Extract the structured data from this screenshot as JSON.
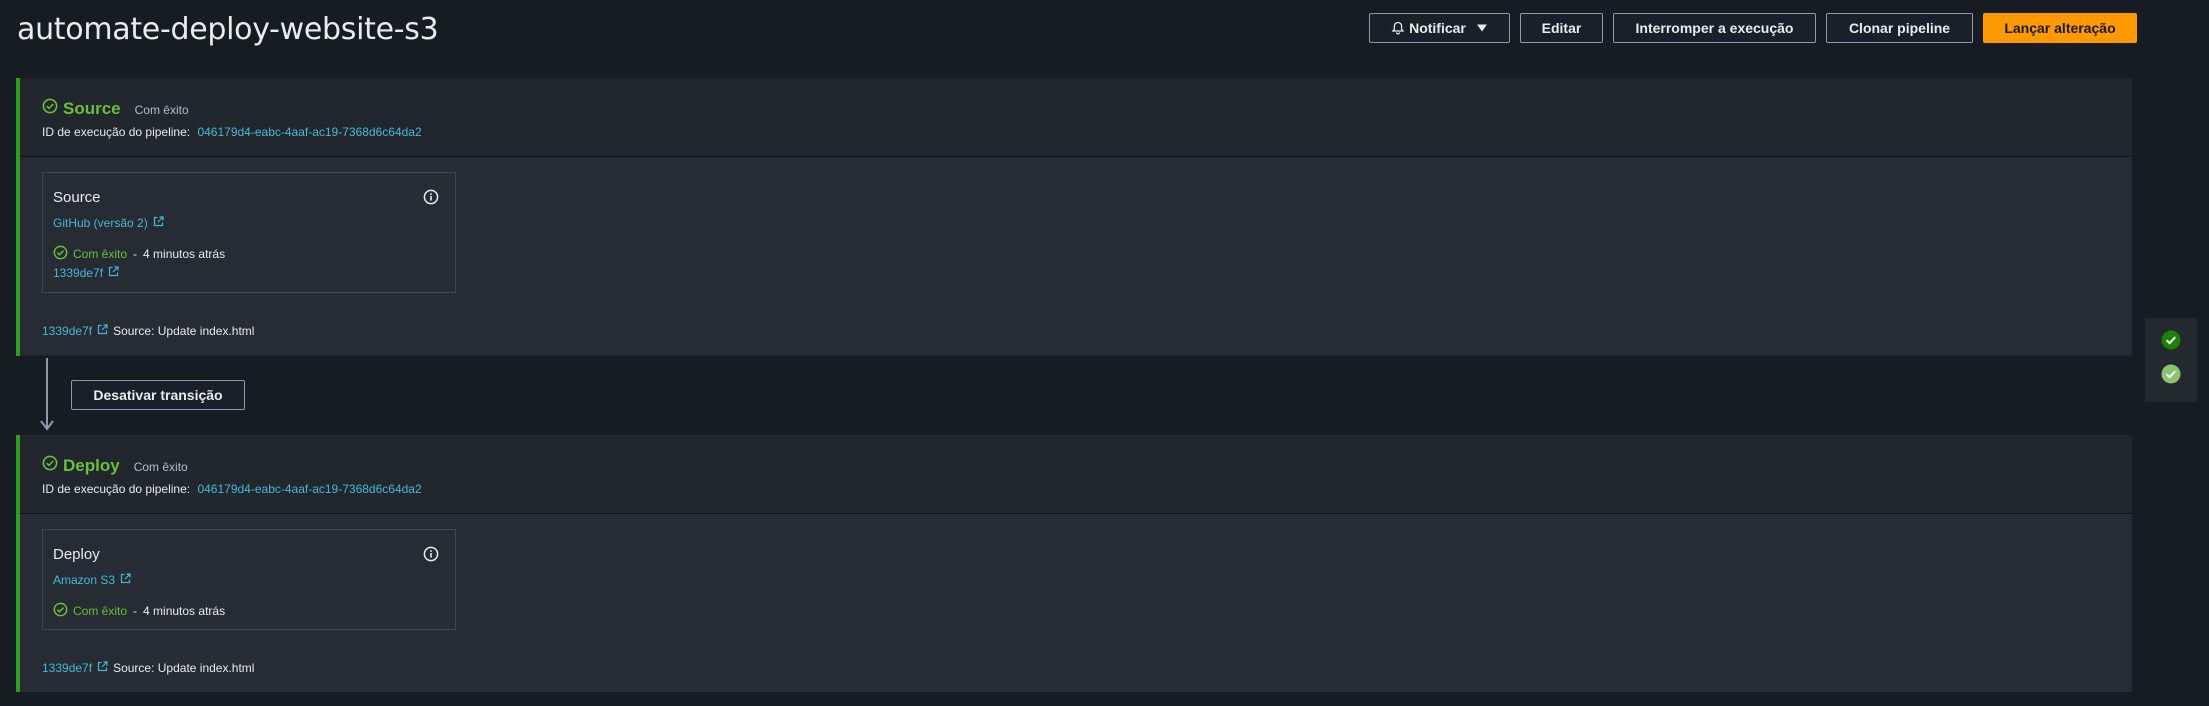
{
  "header": {
    "title": "automate-deploy-website-s3",
    "buttons": {
      "notify": "Notificar",
      "edit": "Editar",
      "stop": "Interromper a execução",
      "clone": "Clonar pipeline",
      "release": "Lançar alteração"
    }
  },
  "colors": {
    "success": "#6abf3b",
    "link": "#44b9d6",
    "primary": "#ff9900",
    "stage_border": "#2f9e1f"
  },
  "stages": [
    {
      "name": "Source",
      "status": "Com êxito",
      "exec_label": "ID de execução do pipeline:",
      "exec_id": "046179d4-eabc-4aaf-ac19-7368d6c64da2",
      "action": {
        "title": "Source",
        "provider": "GitHub (versão 2)",
        "status": "Com êxito",
        "separator": "-",
        "time": "4 minutos atrás",
        "commit": "1339de7f"
      },
      "commit_id": "1339de7f",
      "commit_msg": "Source: Update index.html"
    },
    {
      "name": "Deploy",
      "status": "Com êxito",
      "exec_label": "ID de execução do pipeline:",
      "exec_id": "046179d4-eabc-4aaf-ac19-7368d6c64da2",
      "action": {
        "title": "Deploy",
        "provider": "Amazon S3",
        "status": "Com êxito",
        "separator": "-",
        "time": "4 minutos atrás"
      },
      "commit_id": "1339de7f",
      "commit_msg": "Source: Update index.html"
    }
  ],
  "transition": {
    "button": "Desativar transição"
  },
  "icons": {
    "notify": "bell-icon",
    "dropdown": "caret-down-icon",
    "status": "check-circle-icon",
    "info": "info-icon",
    "external": "external-link-icon",
    "arrow": "arrow-down-icon"
  }
}
